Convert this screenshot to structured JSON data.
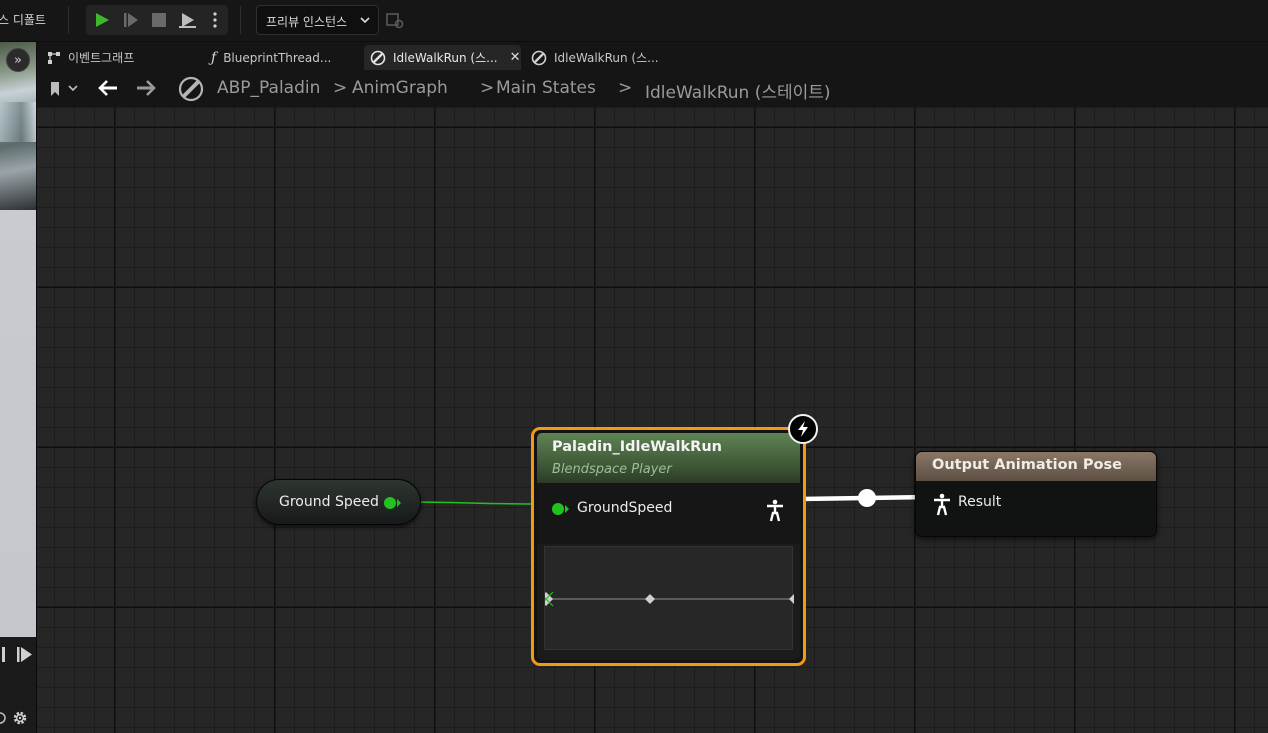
{
  "toolbar": {
    "defaults_label": "스 디폴트",
    "preview_instance_label": "프리뷰 인스턴스"
  },
  "tabs": [
    {
      "label": "이벤트그래프",
      "icon": "event-graph-icon",
      "active": false
    },
    {
      "label": "BlueprintThread...",
      "icon": "function-icon",
      "active": false
    },
    {
      "label": "IdleWalkRun (스...",
      "icon": "anim-state-icon",
      "active": true
    },
    {
      "label": "IdleWalkRun (스...",
      "icon": "anim-state-icon",
      "active": false
    }
  ],
  "breadcrumb": {
    "items": [
      "ABP_Paladin",
      "AnimGraph",
      "Main States",
      "IdleWalkRun (스테이트)"
    ],
    "separator": ">"
  },
  "graph": {
    "variable_node": {
      "label": "Ground Speed",
      "pin_color": "#22c21e"
    },
    "blendspace_node": {
      "title": "Paladin_IdleWalkRun",
      "subtitle": "Blendspace Player",
      "input_pin": "GroundSpeed",
      "selected_color": "#f29a12",
      "header_color": "#4f6f46"
    },
    "output_node": {
      "title": "Output Animation Pose",
      "input_pin": "Result",
      "header_color": "#7a685a"
    }
  },
  "colors": {
    "float_pin": "#22c21e",
    "exec_wire": "#ffffff",
    "play_button": "#3fb72c"
  }
}
